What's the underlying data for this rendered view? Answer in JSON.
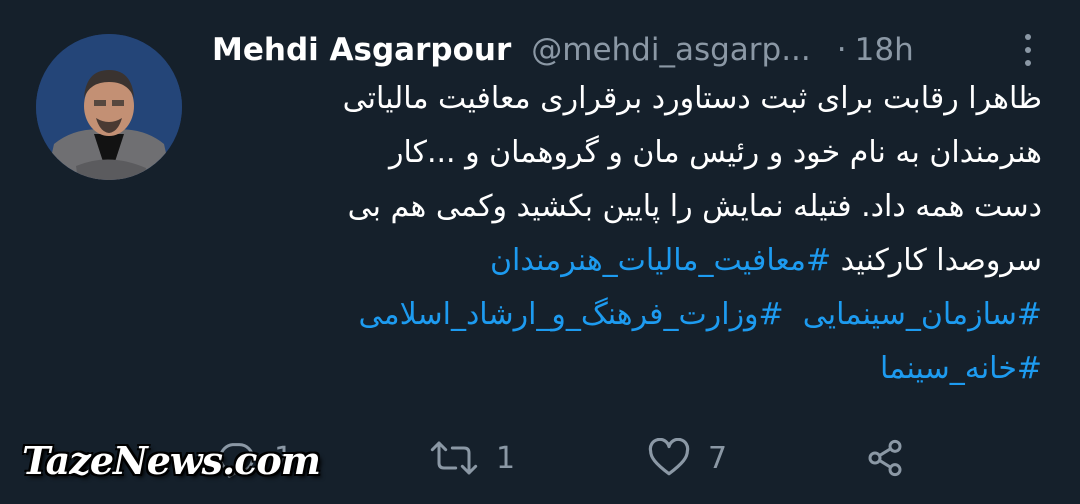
{
  "author": {
    "name": "Mehdi Asgarpour",
    "handle": "@mehdi_asgarp...",
    "separator": "·",
    "time": "18h"
  },
  "tweet": {
    "line1": "ظاهرا رقابت برای ثبت دستاورد برقراری معافیت مالیاتی",
    "line2": "هنرمندان به نام خود و رئیس مان و گروهمان و ...کار",
    "line3": "دست همه داد. فتیله نمایش را پایین بکشید وکمی هم بی",
    "line4_text": "سروصدا  کارکنید ",
    "hashtags": [
      "#معافیت_مالیات_هنرمندان",
      "#سازمان_سینمایی",
      "#وزارت_فرهنگ_و_ارشاد_اسلامی",
      "#خانه_سینما"
    ]
  },
  "actions": {
    "reply": {
      "icon": "reply-icon",
      "count": "1"
    },
    "retweet": {
      "icon": "retweet-icon",
      "count": "1"
    },
    "like": {
      "icon": "heart-icon",
      "count": "7"
    },
    "share": {
      "icon": "share-icon"
    }
  },
  "watermark": "TazeNews.com",
  "colors": {
    "background": "#15202b",
    "text": "#ffffff",
    "secondary": "#8b98a5",
    "hashtag": "#1d9bf0"
  }
}
